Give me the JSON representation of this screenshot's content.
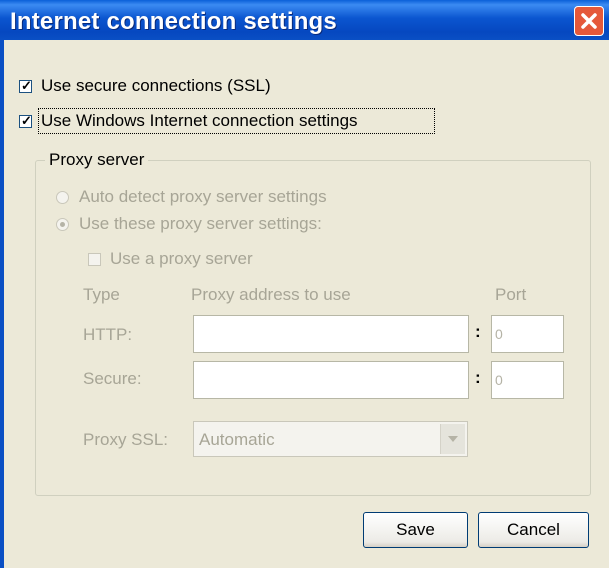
{
  "window": {
    "title": "Internet connection settings",
    "close_icon": "close-x-icon"
  },
  "options": {
    "secure_label": "Use secure connections (SSL)",
    "secure_checked": true,
    "windows_label": "Use Windows Internet connection settings",
    "windows_checked": true
  },
  "proxy": {
    "group_label": "Proxy server",
    "auto_detect_label": "Auto detect proxy server settings",
    "use_these_label": "Use these proxy server settings:",
    "selected_mode": "use_these",
    "use_proxy_label": "Use a proxy server",
    "use_proxy_checked": false,
    "col_type": "Type",
    "col_address": "Proxy address to use",
    "col_port": "Port",
    "rows": [
      {
        "label": "HTTP:",
        "address": "",
        "port": "0"
      },
      {
        "label": "Secure:",
        "address": "",
        "port": "0"
      }
    ],
    "ssl_label": "Proxy SSL:",
    "ssl_value": "Automatic"
  },
  "buttons": {
    "save": "Save",
    "cancel": "Cancel"
  },
  "colors": {
    "titlebar": "#0A4FC4",
    "dialog_bg": "#ECE9D8",
    "close_bg": "#E5583A",
    "disabled_text": "#A7A596"
  }
}
